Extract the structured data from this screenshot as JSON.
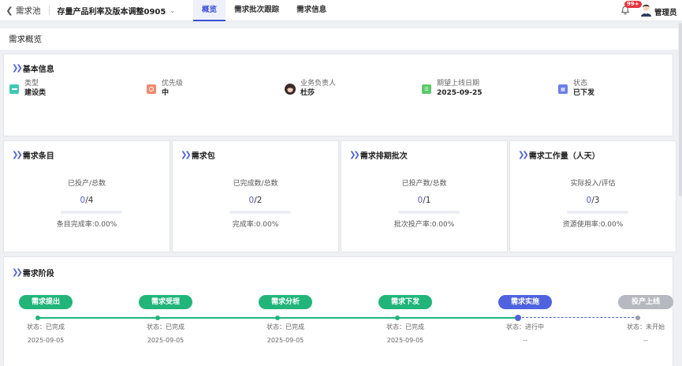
{
  "topbar": {
    "pool": "需求池",
    "project": "存量产品利率及版本调整0905",
    "tabs": [
      "概览",
      "需求批次跟踪",
      "需求信息"
    ],
    "badge": "99+",
    "user": "管理员"
  },
  "overview_title": "需求概览",
  "basic": {
    "title": "基本信息",
    "items": [
      {
        "label": "类型",
        "value": "建设类",
        "icon": "type-icon",
        "color": "#3ec9b6"
      },
      {
        "label": "优先级",
        "value": "中",
        "icon": "priority-icon",
        "color": "#f08a72"
      },
      {
        "label": "业务负责人",
        "value": "杜莎",
        "icon": "owner-avatar-icon",
        "color": "#333"
      },
      {
        "label": "期望上线日期",
        "value": "2025-09-25",
        "icon": "calendar-icon",
        "color": "#5cc96b"
      },
      {
        "label": "状态",
        "value": "已下发",
        "icon": "status-icon",
        "color": "#6b7fe8"
      }
    ]
  },
  "stats": [
    {
      "title": "需求条目",
      "label": "已投产/总数",
      "done": "0",
      "total": "/4",
      "rate": "条目完成率:0.00%"
    },
    {
      "title": "需求包",
      "label": "已完成数/总数",
      "done": "0",
      "total": "/2",
      "rate": "完成率:0.00%"
    },
    {
      "title": "需求排期批次",
      "label": "已投产数/总数",
      "done": "0",
      "total": "/1",
      "rate": "批次投产率:0.00%"
    },
    {
      "title": "需求工作量（人天）",
      "label": "实际投入/评估",
      "done": "0",
      "total": "/3",
      "rate": "资源使用率:0.00%"
    }
  ],
  "stages": {
    "title": "需求阶段",
    "items": [
      {
        "name": "需求提出",
        "status": "状态：已完成",
        "date": "2025-09-05",
        "color": "#21b57a"
      },
      {
        "name": "需求受理",
        "status": "状态：已完成",
        "date": "2025-09-05",
        "color": "#21b57a"
      },
      {
        "name": "需求分析",
        "status": "状态：已完成",
        "date": "2025-09-05",
        "color": "#21b57a"
      },
      {
        "name": "需求下发",
        "status": "状态：已完成",
        "date": "2025-09-05",
        "color": "#21b57a"
      },
      {
        "name": "需求实施",
        "status": "状态：进行中",
        "date": "--",
        "color": "#4f63e0"
      },
      {
        "name": "投产上线",
        "status": "状态：未开始",
        "date": "--",
        "color": "#b6b9c0"
      }
    ]
  }
}
